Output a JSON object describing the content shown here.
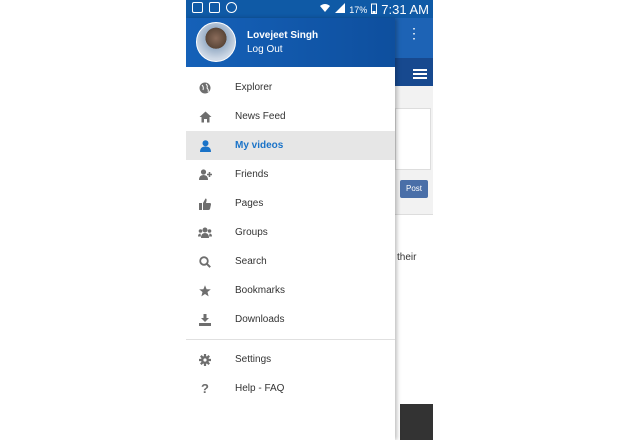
{
  "status_bar": {
    "battery": "17%",
    "time": "7:31 AM"
  },
  "background_app": {
    "post_label": "Post",
    "partial_text": "their"
  },
  "profile": {
    "name": "Lovejeet Singh",
    "logout_label": "Log Out"
  },
  "menu": {
    "items": [
      {
        "label": "Explorer",
        "icon": "globe-icon"
      },
      {
        "label": "News Feed",
        "icon": "home-icon"
      },
      {
        "label": "My videos",
        "icon": "user-icon",
        "active": true
      },
      {
        "label": "Friends",
        "icon": "user-plus-icon"
      },
      {
        "label": "Pages",
        "icon": "thumbs-up-icon"
      },
      {
        "label": "Groups",
        "icon": "users-icon"
      },
      {
        "label": "Search",
        "icon": "search-icon"
      },
      {
        "label": "Bookmarks",
        "icon": "star-icon"
      },
      {
        "label": "Downloads",
        "icon": "download-icon"
      }
    ],
    "secondary": [
      {
        "label": "Settings",
        "icon": "gear-icon"
      },
      {
        "label": "Help - FAQ",
        "icon": "question-icon"
      }
    ]
  },
  "colors": {
    "primary": "#1561b8",
    "active_text": "#1a73c8",
    "active_bg": "#e6e6e6"
  }
}
